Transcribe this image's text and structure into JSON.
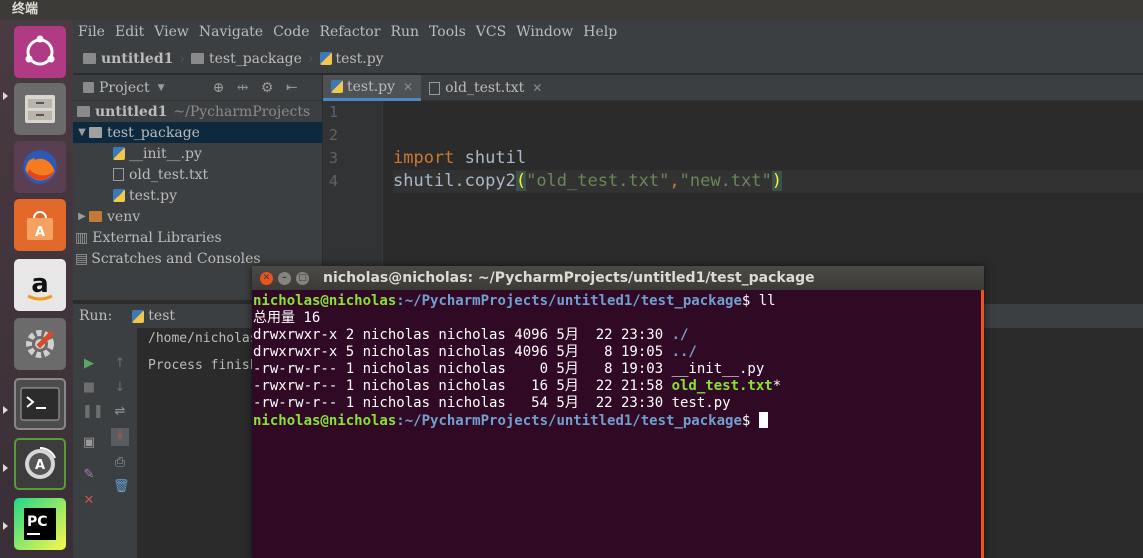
{
  "topbar": {
    "title": "终端"
  },
  "launcher": {
    "items": [
      "ubuntu-dash",
      "files",
      "firefox",
      "software-center",
      "amazon",
      "system-settings",
      "terminal",
      "software-updater",
      "pycharm"
    ]
  },
  "menubar": {
    "items": [
      "File",
      "Edit",
      "View",
      "Navigate",
      "Code",
      "Refactor",
      "Run",
      "Tools",
      "VCS",
      "Window",
      "Help"
    ]
  },
  "navbar": {
    "crumbs": [
      "untitled1",
      "test_package",
      "test.py"
    ]
  },
  "project": {
    "header": "Project",
    "root": "untitled1",
    "root_path": "~/PycharmProjects",
    "package": "test_package",
    "files": [
      "__init__.py",
      "old_test.txt",
      "test.py"
    ],
    "venv": "venv",
    "external": "External Libraries",
    "scratches": "Scratches and Consoles"
  },
  "editor": {
    "tabs": [
      "test.py",
      "old_test.txt"
    ],
    "line_numbers": [
      "1",
      "2",
      "3",
      "4"
    ],
    "code": {
      "l3_kw": "import",
      "l3_rest": " shutil",
      "l4_a": "shutil.copy2",
      "l4_open": "(",
      "l4_s1": "\"old_test.txt\"",
      "l4_comma": ",",
      "l4_s2": "\"new.txt\"",
      "l4_close": ")"
    }
  },
  "run": {
    "label": "Run:",
    "tab": "test",
    "output": [
      "/home/nicholas/",
      "Process finishe"
    ]
  },
  "terminal": {
    "title": "nicholas@nicholas: ~/PycharmProjects/untitled1/test_package",
    "prompt_user": "nicholas@nicholas",
    "prompt_path": ":~/PycharmProjects/untitled1/test_package",
    "cmd": "$ ll",
    "total": "总用量 16",
    "rows": [
      {
        "meta": "drwxrwxr-x 2 nicholas nicholas 4096 5月  22 23:30 ",
        "name": "./"
      },
      {
        "meta": "drwxrwxr-x 5 nicholas nicholas 4096 5月   8 19:05 ",
        "name": "../"
      },
      {
        "meta": "-rw-rw-r-- 1 nicholas nicholas    0 5月   8 19:03 ",
        "name": "__init__.py"
      },
      {
        "meta": "-rwxrw-r-- 1 nicholas nicholas   16 5月  22 21:58 ",
        "name": "old_test.txt",
        "suffix": "*"
      },
      {
        "meta": "-rw-rw-r-- 1 nicholas nicholas   54 5月  22 23:30 ",
        "name": "test.py"
      }
    ],
    "prompt_end": "$ "
  },
  "colors": {
    "terminal_bg": "#300a24",
    "accent": "#e95420",
    "keyword": "#cc7832",
    "string": "#6a8759"
  }
}
